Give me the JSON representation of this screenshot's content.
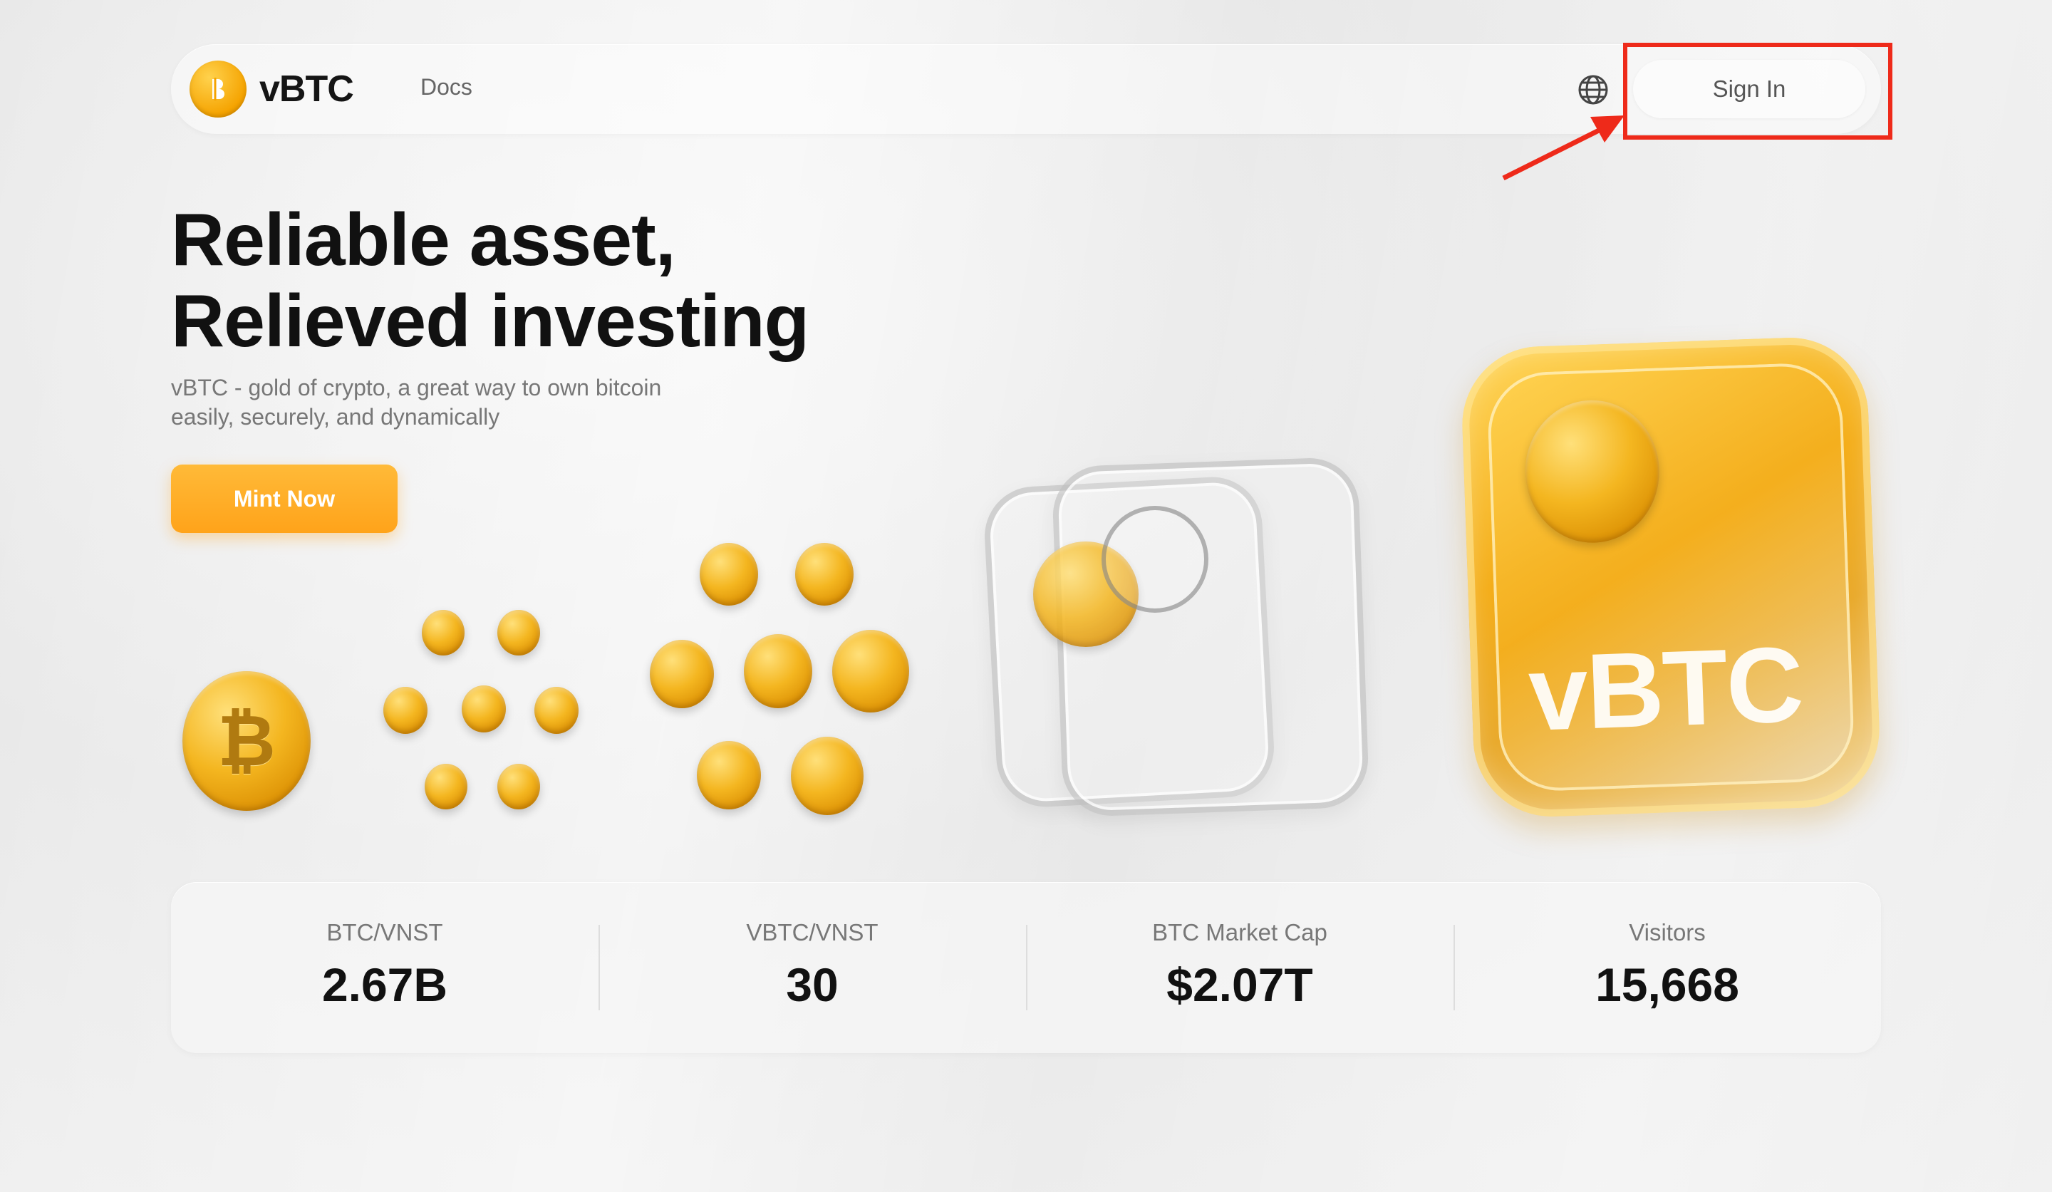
{
  "brand": {
    "name": "vBTC",
    "accent": "#F5A300"
  },
  "nav": {
    "docs_label": "Docs",
    "globe_icon": "globe-icon",
    "signin_label": "Sign In"
  },
  "annotation": {
    "highlight_color": "#EE2A1A"
  },
  "hero": {
    "title_line1": "Reliable asset,",
    "title_line2": "Relieved investing",
    "subtitle_line1": "vBTC - gold of crypto, a great way to own bitcoin",
    "subtitle_line2": "easily, securely, and dynamically",
    "cta_label": "Mint Now"
  },
  "art": {
    "btc_symbol": "₿",
    "card_text": "vBTC"
  },
  "stats": [
    {
      "label": "BTC/VNST",
      "value": "2.67B"
    },
    {
      "label": "VBTC/VNST",
      "value": "30"
    },
    {
      "label": "BTC Market Cap",
      "value": "$2.07T"
    },
    {
      "label": "Visitors",
      "value": "15,668"
    }
  ]
}
